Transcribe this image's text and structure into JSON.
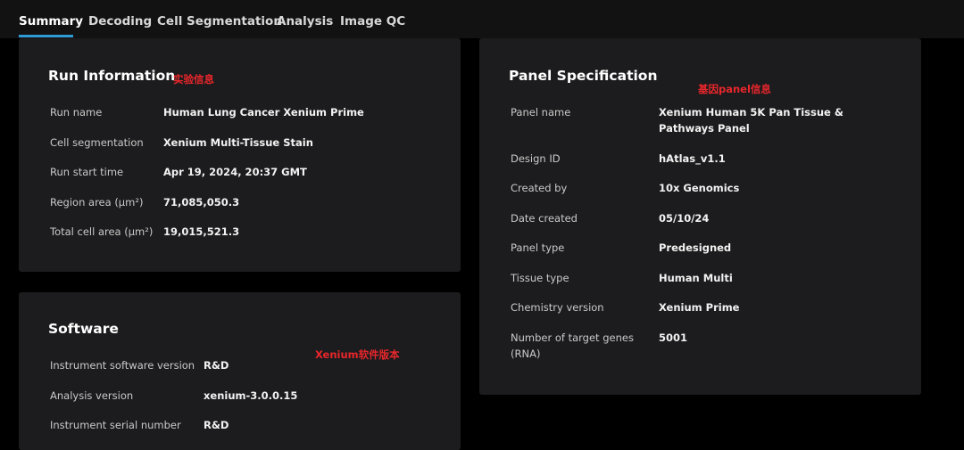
{
  "tabs": [
    {
      "label": "Summary",
      "active": true
    },
    {
      "label": "Decoding",
      "active": false
    },
    {
      "label": "Cell Segmentation",
      "active": false
    },
    {
      "label": "Analysis",
      "active": false
    },
    {
      "label": "Image QC",
      "active": false
    }
  ],
  "run_info": {
    "title": "Run Information",
    "annotation": "实验信息",
    "rows": [
      {
        "label": "Run name",
        "value": "Human Lung Cancer Xenium Prime"
      },
      {
        "label": "Cell segmentation",
        "value": "Xenium Multi-Tissue Stain"
      },
      {
        "label": "Run start time",
        "value": "Apr 19, 2024, 20:37 GMT"
      },
      {
        "label": "Region area (µm²)",
        "value": "71,085,050.3"
      },
      {
        "label": "Total cell area (µm²)",
        "value": "19,015,521.3"
      }
    ]
  },
  "software": {
    "title": "Software",
    "annotation": "Xenium软件版本",
    "rows": [
      {
        "label": "Instrument software version",
        "value": "R&D"
      },
      {
        "label": "Analysis version",
        "value": "xenium-3.0.0.15"
      },
      {
        "label": "Instrument serial number",
        "value": "R&D"
      }
    ]
  },
  "panel_spec": {
    "title": "Panel Specification",
    "annotation": "基因panel信息",
    "rows": [
      {
        "label": "Panel name",
        "value": "Xenium Human 5K Pan Tissue & Pathways Panel"
      },
      {
        "label": "Design ID",
        "value": "hAtlas_v1.1"
      },
      {
        "label": "Created by",
        "value": "10x Genomics"
      },
      {
        "label": "Date created",
        "value": "05/10/24"
      },
      {
        "label": "Panel type",
        "value": "Predesigned"
      },
      {
        "label": "Tissue type",
        "value": "Human Multi"
      },
      {
        "label": "Chemistry version",
        "value": "Xenium Prime"
      },
      {
        "label": "Number of target genes (RNA)",
        "value": "5001"
      }
    ]
  },
  "colors": {
    "accent": "#2f9bd6",
    "annotation": "#e8262b",
    "card_bg": "#1c1c1e",
    "page_bg": "#000000"
  }
}
